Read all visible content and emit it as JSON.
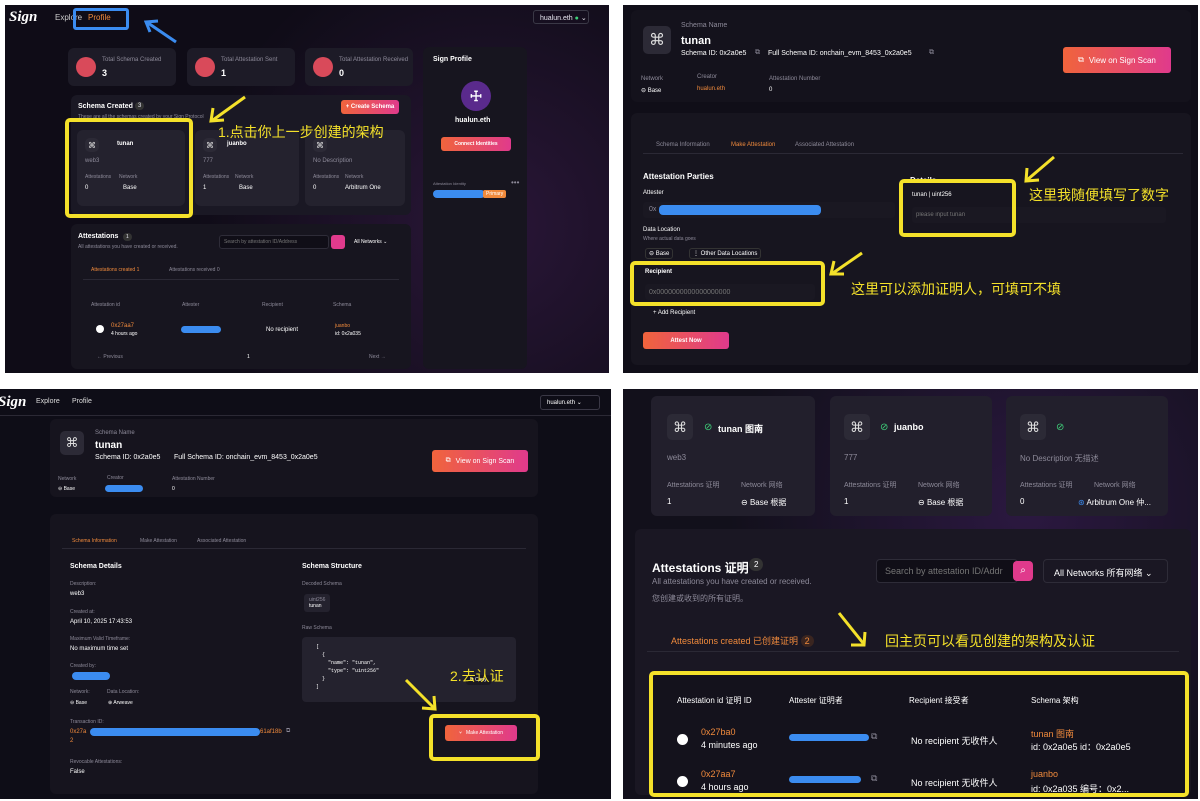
{
  "p1": {
    "logo": "Sign",
    "nav": [
      "Explore",
      "Profile"
    ],
    "wallet": "hualun.eth",
    "stats": [
      {
        "label": "Total Schema Created",
        "value": "3"
      },
      {
        "label": "Total Attestation Sent",
        "value": "1"
      },
      {
        "label": "Total Attestation Received",
        "value": "0"
      }
    ],
    "schema_created_title": "Schema Created",
    "schema_count": "3",
    "schema_desc": "These are all the schemas created by your Sign Protocol",
    "create_schema": "+ Create Schema",
    "annotation": "1.点击你上一步创建的架构",
    "cards": [
      {
        "name": "tunan",
        "desc": "web3",
        "attest_label": "Attestations",
        "attest": "0",
        "net_label": "Network",
        "net": "Base"
      },
      {
        "name": "juanbo",
        "desc": "777",
        "attest_label": "Attestations",
        "attest": "1",
        "net_label": "Network",
        "net": "Base"
      },
      {
        "name": "",
        "desc": "No Description",
        "attest_label": "Attestations",
        "attest": "0",
        "net_label": "Network",
        "net": "Arbitrum One"
      }
    ],
    "profile_title": "Sign Profile",
    "profile_name": "hualun.eth",
    "connect_btn": "Connect Identities",
    "identity_label": "Attestation Identity",
    "primary": "Primary",
    "attest_title": "Attestations",
    "attest_count": "1",
    "attest_desc": "All attestations you have created or received.",
    "search_placeholder": "Search by attestation ID/Address",
    "networks": "All Networks",
    "tab_created": "Attestations created",
    "tab_created_count": "1",
    "tab_received": "Attestations received",
    "tab_received_count": "0",
    "cols": [
      "Attestation id",
      "Attester",
      "Recipient",
      "Schema"
    ],
    "row": {
      "id": "0x27aa7",
      "time": "4 hours ago",
      "recipient": "No recipient",
      "schema": "juanbo",
      "schema_id": "id: 0x2a035"
    },
    "prev": "← Previous",
    "page": "1",
    "next": "Next →"
  },
  "p2": {
    "schema_name_label": "Schema Name",
    "schema_name": "tunan",
    "schema_id": "Schema ID: 0x2a0e5",
    "full_schema_id": "Full Schema ID: onchain_evm_8453_0x2a0e5",
    "network_label": "Network",
    "network": "Base",
    "creator_label": "Creator",
    "creator": "hualun.eth",
    "attest_num_label": "Attestation Number",
    "attest_num": "0",
    "view_btn": "View on Sign Scan",
    "tabs": [
      "Schema Information",
      "Make Attestation",
      "Associated Attestation"
    ],
    "parties_title": "Attestation Parties",
    "attester_label": "Attester",
    "attester_prefix": "0x",
    "data_loc_label": "Data Location",
    "data_loc_desc": "Where actual data goes",
    "loc_base": "Base",
    "loc_other": "Other Data Locations",
    "recipient_label": "Recipient",
    "recipient_placeholder": "0x0000000000000000000",
    "add_recipient": "+ Add Recipient",
    "attest_now": "Attest Now",
    "details_title": "Details",
    "details_field": "tunan | uint256",
    "details_placeholder": "please input tunan",
    "anno1": "这里我随便填写了数字",
    "anno2": "这里可以添加证明人，可填可不填"
  },
  "p3": {
    "logo": "Sign",
    "nav": [
      "Explore",
      "Profile"
    ],
    "wallet": "hualun.eth",
    "schema_name_label": "Schema Name",
    "schema_name": "tunan",
    "schema_id": "Schema ID: 0x2a0e5",
    "full_schema_id": "Full Schema ID: onchain_evm_8453_0x2a0e5",
    "network_label": "Network",
    "network": "Base",
    "creator_label": "Creator",
    "attest_num_label": "Attestation Number",
    "attest_num": "0",
    "view_btn": "View on Sign Scan",
    "tabs": [
      "Schema Information",
      "Make Attestation",
      "Associated Attestation"
    ],
    "details_title": "Schema Details",
    "desc_label": "Description:",
    "desc": "web3",
    "created_at_label": "Created at:",
    "created_at": "April 10, 2025 17:43:53",
    "max_valid_label": "Maximum Valid Timeframe:",
    "max_valid": "No maximum time set",
    "created_by_label": "Created by:",
    "network_l2": "Network:",
    "network_v2": "Base",
    "data_loc_l": "Data Location:",
    "data_loc_v": "Arweave",
    "tx_label": "Transaction ID:",
    "tx_prefix": "0x27a",
    "tx_suffix": "61af18b",
    "tx_tail": "2",
    "revocable_label": "Revocable Attestations:",
    "revocable": "False",
    "structure_title": "Schema Structure",
    "decoded_label": "Decoded Schema",
    "decoded_type": "uint256",
    "decoded_name": "tunan",
    "raw_label": "Raw Schema",
    "code_lines": [
      "[",
      "  {",
      "    \"name\": \"tunan\",",
      "    \"type\": \"uint256\"",
      "  }",
      "]"
    ],
    "copy": "Copy",
    "make_attest_btn": "Make Attestation",
    "anno": "2.去认证"
  },
  "p4": {
    "cards": [
      {
        "name": "tunan 图南",
        "desc": "web3",
        "attest_label": "Attestations 证明",
        "attest": "1",
        "net_label": "Network 网络",
        "net": "Base 根据"
      },
      {
        "name": "juanbo",
        "desc": "777",
        "attest_label": "Attestations 证明",
        "attest": "1",
        "net_label": "Network 网络",
        "net": "Base 根据"
      },
      {
        "name": "",
        "desc": "No Description 无描述",
        "attest_label": "Attestations 证明",
        "attest": "0",
        "net_label": "Network 网络",
        "net": "Arbitrum One 仲..."
      }
    ],
    "title": "Attestations 证明",
    "count": "2",
    "desc_en": "All attestations you have created or received.",
    "desc_cn": "您创建或收到的所有证明。",
    "search_placeholder": "Search by attestation ID/Addr",
    "networks": "All Networks 所有网络",
    "tab_created": "Attestations created 已创建证明",
    "tab_count": "2",
    "anno": "回主页可以看见创建的架构及认证",
    "cols": [
      "Attestation id 证明 ID",
      "Attester 证明者",
      "Recipient 接受者",
      "Schema 架构"
    ],
    "rows": [
      {
        "id": "0x27ba0",
        "time": "4 minutes ago",
        "recipient": "No recipient 无收件人",
        "schema": "tunan 图南",
        "schema_id": "id: 0x2a0e5 id：0x2a0e5"
      },
      {
        "id": "0x27aa7",
        "time": "4 hours ago",
        "recipient": "No recipient 无收件人",
        "schema": "juanbo",
        "schema_id": "id: 0x2a035 编号：0x2..."
      }
    ]
  },
  "colors": {
    "accent_orange": "#f08a3c",
    "annotation_yellow": "#f4e12a",
    "highlight_blue": "#3b8cf0",
    "button_grad_start": "#f0643c",
    "button_grad_end": "#e03a8c"
  }
}
